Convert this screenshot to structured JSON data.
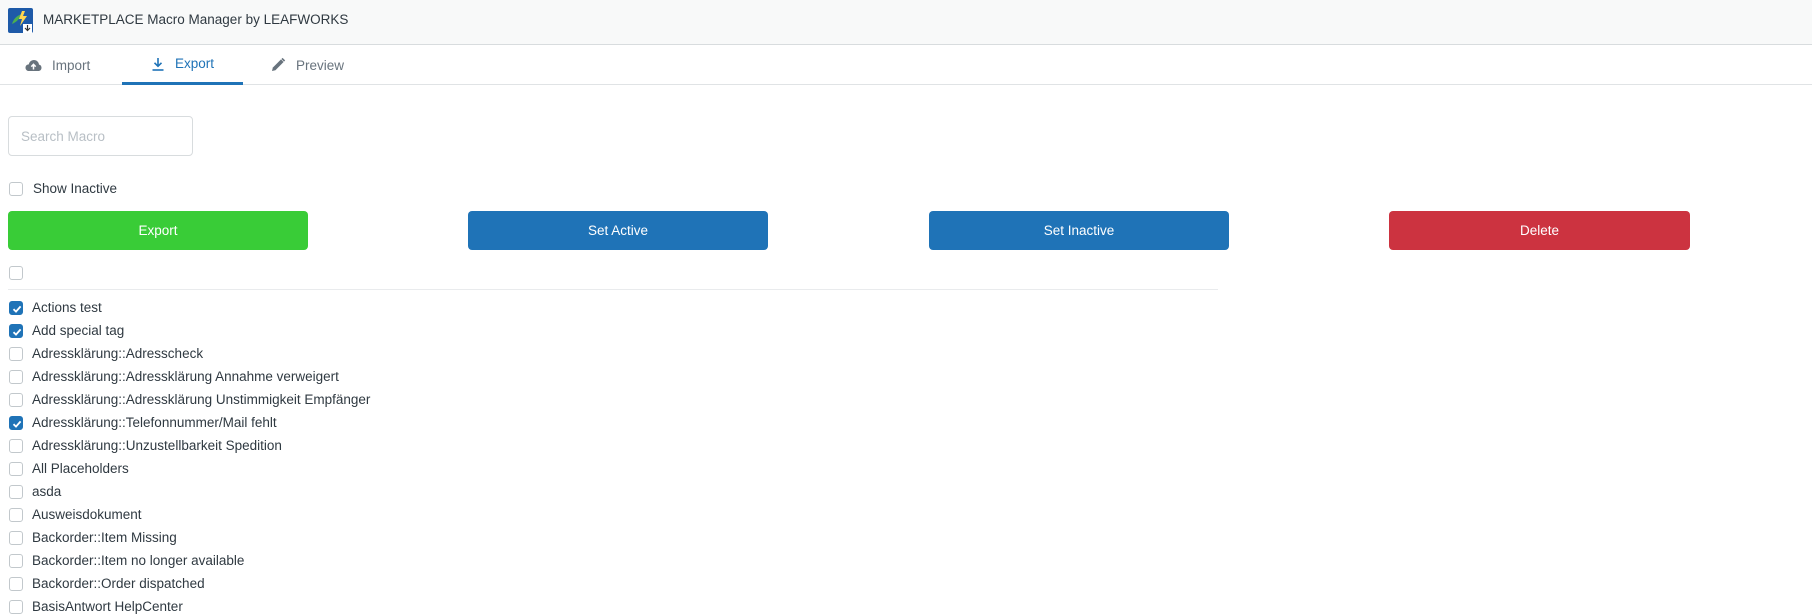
{
  "app": {
    "title": "MARKETPLACE Macro Manager by LEAFWORKS",
    "logo_icon": "leafworks-logo"
  },
  "tabs": [
    {
      "label": "Import",
      "icon": "cloud-upload-icon",
      "active": false
    },
    {
      "label": "Export",
      "icon": "download-icon",
      "active": true
    },
    {
      "label": "Preview",
      "icon": "pencil-icon",
      "active": false
    }
  ],
  "search": {
    "placeholder": "Search Macro",
    "value": ""
  },
  "show_inactive": {
    "label": "Show Inactive",
    "checked": false
  },
  "actions": {
    "export_label": "Export",
    "set_active_label": "Set Active",
    "set_inactive_label": "Set Inactive",
    "delete_label": "Delete"
  },
  "colors": {
    "export": "#39cc37",
    "set_active": "#1f73b7",
    "set_inactive": "#1f73b7",
    "delete": "#cc3340",
    "accent": "#1f73b7"
  },
  "select_all": {
    "checked": false
  },
  "macros": [
    {
      "label": "Actions test",
      "checked": true
    },
    {
      "label": "Add special tag",
      "checked": true
    },
    {
      "label": "Adressklärung::Adresscheck",
      "checked": false
    },
    {
      "label": "Adressklärung::Adressklärung Annahme verweigert",
      "checked": false
    },
    {
      "label": "Adressklärung::Adressklärung Unstimmigkeit Empfänger",
      "checked": false
    },
    {
      "label": "Adressklärung::Telefonnummer/Mail fehlt",
      "checked": true
    },
    {
      "label": "Adressklärung::Unzustellbarkeit Spedition",
      "checked": false
    },
    {
      "label": "All Placeholders",
      "checked": false
    },
    {
      "label": "asda",
      "checked": false
    },
    {
      "label": "Ausweisdokument",
      "checked": false
    },
    {
      "label": "Backorder::Item Missing",
      "checked": false
    },
    {
      "label": "Backorder::Item no longer available",
      "checked": false
    },
    {
      "label": "Backorder::Order dispatched",
      "checked": false
    },
    {
      "label": "BasisAntwort HelpCenter",
      "checked": false
    }
  ]
}
